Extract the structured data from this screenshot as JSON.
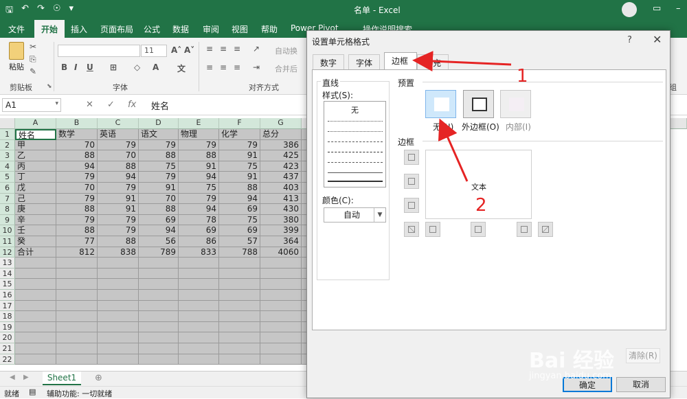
{
  "window": {
    "title": "名单 - Excel"
  },
  "tabs": [
    "文件",
    "开始",
    "插入",
    "页面布局",
    "公式",
    "数据",
    "审阅",
    "视图",
    "帮助",
    "Power Pivot",
    "操作说明搜索"
  ],
  "ribbon": {
    "clipboard": {
      "paste": "粘贴",
      "label": "剪贴板"
    },
    "font": {
      "size": "11",
      "grow": "A˄",
      "shrink": "A˅",
      "bold": "B",
      "italic": "I",
      "underline": "U",
      "label": "字体"
    },
    "alignment": {
      "wrap": "自动换",
      "merge": "合并后",
      "label": "对齐方式"
    },
    "right_label": "组"
  },
  "formula_bar": {
    "name_box": "A1",
    "fx": "fx",
    "content": "姓名"
  },
  "grid": {
    "columns": [
      "A",
      "B",
      "C",
      "D",
      "E",
      "F",
      "G"
    ],
    "rows": [
      [
        "姓名",
        "数学",
        "英语",
        "语文",
        "物理",
        "化学",
        "总分"
      ],
      [
        "甲",
        "70",
        "79",
        "79",
        "79",
        "79",
        "386"
      ],
      [
        "乙",
        "88",
        "70",
        "88",
        "88",
        "91",
        "425"
      ],
      [
        "丙",
        "94",
        "88",
        "75",
        "91",
        "75",
        "423"
      ],
      [
        "丁",
        "79",
        "94",
        "79",
        "94",
        "91",
        "437"
      ],
      [
        "戊",
        "70",
        "79",
        "91",
        "75",
        "88",
        "403"
      ],
      [
        "己",
        "79",
        "91",
        "70",
        "79",
        "94",
        "413"
      ],
      [
        "庚",
        "88",
        "91",
        "88",
        "94",
        "69",
        "430"
      ],
      [
        "辛",
        "79",
        "79",
        "69",
        "78",
        "75",
        "380"
      ],
      [
        "壬",
        "88",
        "79",
        "94",
        "69",
        "69",
        "399"
      ],
      [
        "癸",
        "77",
        "88",
        "56",
        "86",
        "57",
        "364"
      ],
      [
        "合计",
        "812",
        "838",
        "789",
        "833",
        "788",
        "4060"
      ]
    ],
    "row_count": 22
  },
  "sheet_tab": "Sheet1",
  "status": {
    "ready": "就绪",
    "accessibility": "辅助功能: 一切就绪"
  },
  "dialog": {
    "title": "设置单元格格式",
    "help": "?",
    "close": "✕",
    "tabs": [
      "数字",
      "字体",
      "边框",
      "填充"
    ],
    "active_tab": "边框",
    "line_group": "直线",
    "style_label": "样式(S):",
    "style_none": "无",
    "color_label": "颜色(C):",
    "color_value": "自动",
    "preset_group": "预置",
    "presets": [
      "无(N)",
      "外边框(O)",
      "内部(I)"
    ],
    "border_group": "边框",
    "preview_text": "文本",
    "ok": "确定",
    "cancel": "取消",
    "clear": "清除(R)"
  },
  "annotations": {
    "num1": "1",
    "num2": "2",
    "arrow_color": "#e52424"
  },
  "watermark": {
    "brand": "Bai 经验",
    "url": "jingyan.baidu.com"
  },
  "colors": {
    "excel_green": "#217346",
    "header_green": "#d3e7da",
    "selected_range": "#c6c6c6"
  }
}
